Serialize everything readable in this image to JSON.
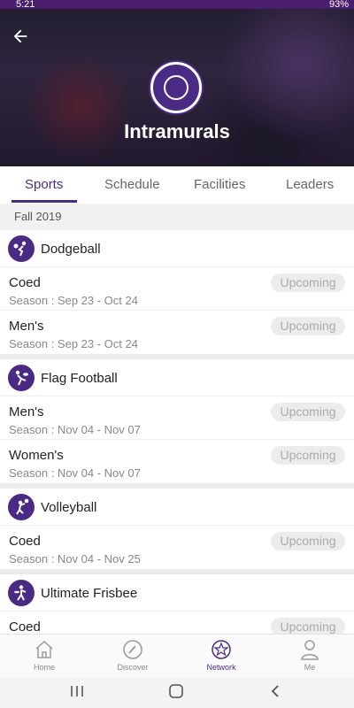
{
  "status": {
    "time": "5:21",
    "battery": "93%"
  },
  "header": {
    "title": "Intramurals",
    "back_icon": "arrow-left-icon"
  },
  "tabs": [
    {
      "label": "Sports"
    },
    {
      "label": "Schedule"
    },
    {
      "label": "Facilities"
    },
    {
      "label": "Leaders"
    }
  ],
  "season_label": "Fall 2019",
  "sports": [
    {
      "name": "Dodgeball",
      "icon": "dodgeball-icon",
      "divisions": [
        {
          "name": "Coed",
          "season": "Season : Sep 23 - Oct 24",
          "status": "Upcoming"
        },
        {
          "name": "Men's",
          "season": "Season : Sep 23 - Oct 24",
          "status": "Upcoming"
        }
      ]
    },
    {
      "name": "Flag Football",
      "icon": "flag-football-icon",
      "divisions": [
        {
          "name": "Men's",
          "season": "Season : Nov 04 - Nov 07",
          "status": "Upcoming"
        },
        {
          "name": "Women's",
          "season": "Season : Nov 04 - Nov 07",
          "status": "Upcoming"
        }
      ]
    },
    {
      "name": "Volleyball",
      "icon": "volleyball-icon",
      "divisions": [
        {
          "name": "Coed",
          "season": "Season : Nov 04 - Nov 25",
          "status": "Upcoming"
        }
      ]
    },
    {
      "name": "Ultimate Frisbee",
      "icon": "frisbee-icon",
      "divisions": [
        {
          "name": "Coed",
          "season": "",
          "status": "Upcoming"
        }
      ]
    }
  ],
  "bottom_nav": [
    {
      "label": "Home",
      "icon": "home-icon"
    },
    {
      "label": "Discover",
      "icon": "compass-icon"
    },
    {
      "label": "Network",
      "icon": "network-star-icon"
    },
    {
      "label": "Me",
      "icon": "person-icon"
    }
  ],
  "colors": {
    "accent": "#4b2a86",
    "badge_bg": "#ececec",
    "badge_text": "#aaaaaa"
  }
}
